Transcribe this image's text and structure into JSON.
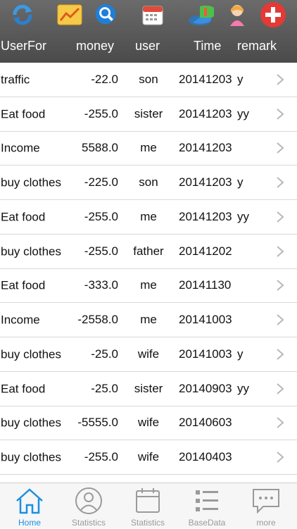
{
  "toolbar": {
    "icons": [
      "refresh-icon",
      "chart-icon",
      "search-icon",
      "calendar-icon",
      "pie-chart-icon",
      "avatar-icon",
      "add-icon"
    ],
    "add_color": "#e53935"
  },
  "columns": {
    "category": "UserFor",
    "money": "money",
    "user": "user",
    "time": "Time",
    "remark": "remark"
  },
  "records": [
    {
      "category": "traffic",
      "money": "-22.0",
      "user": "son",
      "time": "20141203",
      "remark": "y"
    },
    {
      "category": "Eat food",
      "money": "-255.0",
      "user": "sister",
      "time": "20141203",
      "remark": "yy"
    },
    {
      "category": "Income",
      "money": "5588.0",
      "user": "me",
      "time": "20141203",
      "remark": ""
    },
    {
      "category": "buy clothes",
      "money": "-225.0",
      "user": "son",
      "time": "20141203",
      "remark": "y"
    },
    {
      "category": "Eat food",
      "money": "-255.0",
      "user": "me",
      "time": "20141203",
      "remark": "yy"
    },
    {
      "category": "buy clothes",
      "money": "-255.0",
      "user": "father",
      "time": "20141202",
      "remark": ""
    },
    {
      "category": "Eat food",
      "money": "-333.0",
      "user": "me",
      "time": "20141130",
      "remark": ""
    },
    {
      "category": "Income",
      "money": "-2558.0",
      "user": "me",
      "time": "20141003",
      "remark": ""
    },
    {
      "category": "buy clothes",
      "money": "-25.0",
      "user": "wife",
      "time": "20141003",
      "remark": "y"
    },
    {
      "category": "Eat food",
      "money": "-25.0",
      "user": "sister",
      "time": "20140903",
      "remark": "yy"
    },
    {
      "category": "buy clothes",
      "money": "-5555.0",
      "user": "wife",
      "time": "20140603",
      "remark": ""
    },
    {
      "category": "buy clothes",
      "money": "-255.0",
      "user": "wife",
      "time": "20140403",
      "remark": ""
    }
  ],
  "tabs": [
    {
      "label": "Home",
      "icon": "home-icon",
      "active": true
    },
    {
      "label": "Statistics",
      "icon": "user-icon",
      "active": false
    },
    {
      "label": "Statistics",
      "icon": "calendar-icon",
      "active": false
    },
    {
      "label": "BaseData",
      "icon": "list-icon",
      "active": false
    },
    {
      "label": "more",
      "icon": "chat-bubble-icon",
      "active": false
    }
  ],
  "colors": {
    "header": "#555555",
    "accent": "#1a8fe3"
  }
}
